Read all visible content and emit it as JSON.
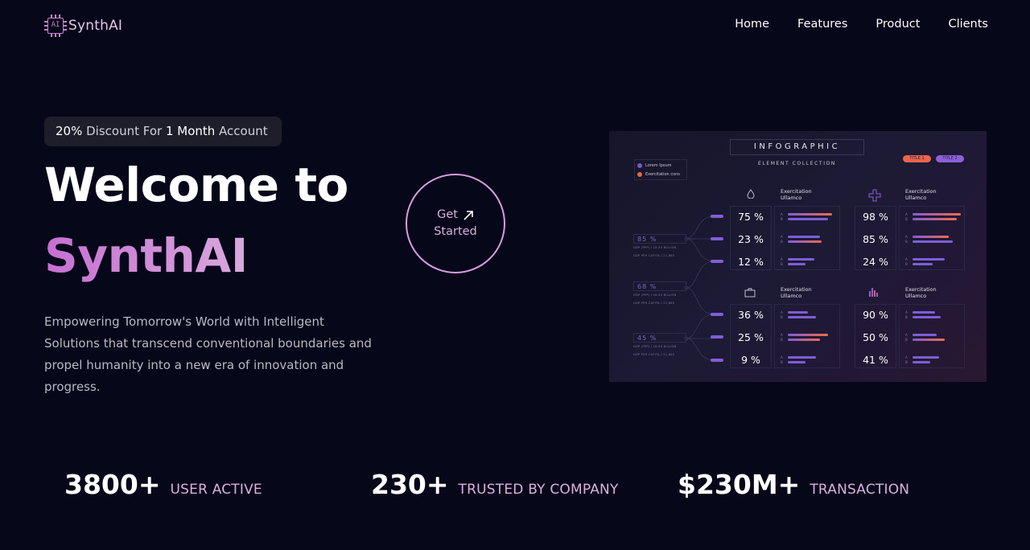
{
  "brand": {
    "logo_chip_text": "AI",
    "name": "SynthAI",
    "accent": "#c77dce"
  },
  "nav": [
    {
      "label": "Home"
    },
    {
      "label": "Features"
    },
    {
      "label": "Product"
    },
    {
      "label": "Clients"
    }
  ],
  "hero": {
    "promo": {
      "pct": "20%",
      "mid": " Discount For ",
      "period": "1 Month",
      "end": " Account"
    },
    "title_line1": "Welcome to",
    "title_line2": "SynthAI",
    "description": "Empowering Tomorrow's World with Intelligent Solutions that transcend conventional boundaries and propel humanity into a new era of innovation and progress.",
    "cta_line1": "Get",
    "cta_line2": "Started",
    "cta_icon": "arrow-up-right-icon"
  },
  "infographic": {
    "title": "INFOGRAPHIC",
    "subtitle": "ELEMENT COLLECTION",
    "legend": [
      {
        "label": "Lorem Ipsum",
        "color": "#7b55c9"
      },
      {
        "label": "Exercitation cons",
        "color": "#e9654c"
      }
    ],
    "pills": [
      {
        "label": "TITLE 1",
        "color": "#e9654c"
      },
      {
        "label": "TITLE 2",
        "color": "#8a62d6"
      }
    ],
    "side_values": [
      {
        "value": "85 %",
        "cap1": "GDP (PPP) / 18.50 BILLION",
        "cap2": "GDP PER CAPITA / 21,885"
      },
      {
        "value": "68 %",
        "cap1": "GDP (PPP) / 18.50 BILLION",
        "cap2": "GDP PER CAPITA / 21,885"
      },
      {
        "value": "45 %",
        "cap1": "GDP (PPP) / 18.50 BILLION",
        "cap2": "GDP PER CAPITA / 21,885"
      }
    ],
    "sections": [
      {
        "head1": "Exercitation",
        "head2": "Ullamco",
        "icon": "drop-icon",
        "values": [
          "75 %",
          "23 %",
          "12 %"
        ]
      },
      {
        "head1": "Exercitation",
        "head2": "Ullamco",
        "icon": "plus-icon",
        "values": [
          "98 %",
          "85 %",
          "24 %"
        ]
      },
      {
        "head1": "Exercitation",
        "head2": "Ullamco",
        "icon": "briefcase-icon",
        "values": [
          "36 %",
          "25 %",
          "9 %"
        ]
      },
      {
        "head1": "Exercitation",
        "head2": "Ullamco",
        "icon": "bar-chart-icon",
        "values": [
          "90 %",
          "50 %",
          "41 %"
        ]
      }
    ],
    "bar_letters": [
      "A",
      "B"
    ],
    "colors": {
      "purple": "#7d5ed6",
      "orange": "#f06a4c"
    }
  },
  "stats": [
    {
      "number": "3800+",
      "label": "USER ACTIVE"
    },
    {
      "number": "230+",
      "label": "TRUSTED BY COMPANY"
    },
    {
      "number": "$230M+",
      "label": "TRANSACTION"
    }
  ]
}
